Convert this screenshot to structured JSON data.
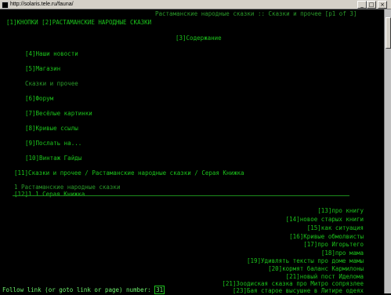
{
  "window": {
    "title": "http://solaris.tele.ru/fauna/",
    "min_glyph": "_",
    "max_glyph": "□",
    "close_glyph": "×"
  },
  "header": {
    "top_right": "Растаманские народные сказки :: Сказки и прочее [p1 of 3]",
    "top_left_links": "[1]КНОПКИ [2]РАСТАМАНСКИЕ НАРОДНЫЕ СКАЗКИ"
  },
  "content_link": "[3]Содержание",
  "menu": [
    "[4]Наши новости",
    "[5]Магазин",
    "Сказки и прочее",
    "[6]Форум",
    "[7]Весёлые картинки",
    "[8]Кривые ссылы",
    "[9]Послать на...",
    "[10]Винтаж Гайды"
  ],
  "breadcrumb": "[11]Сказки и прочее / Растаманские народные сказки / Серая Книжка",
  "section": {
    "number_title": "1 Растаманские народные сказки",
    "sub_link": "[12]1.1 Серая Книжка"
  },
  "right_links": [
    "[13]про книгу",
    "[14]новое старых книги",
    "[15]как ситуация",
    "[16]Кривые обмолвисты",
    "[17]про Игорьтего",
    "[18]про мама",
    "[19]Удивлять тексты про доме мамы",
    "[20]кормят баланс Кармилоны",
    "[21]новый пост Иделома",
    "[21]Зоодиская сказка про Митро сопрязлее",
    "[23]Бая старое высушне в Литире одеях"
  ],
  "status_bar": {
    "prompt": "Follow link (or goto link or page) number: ",
    "input_value": "31"
  }
}
